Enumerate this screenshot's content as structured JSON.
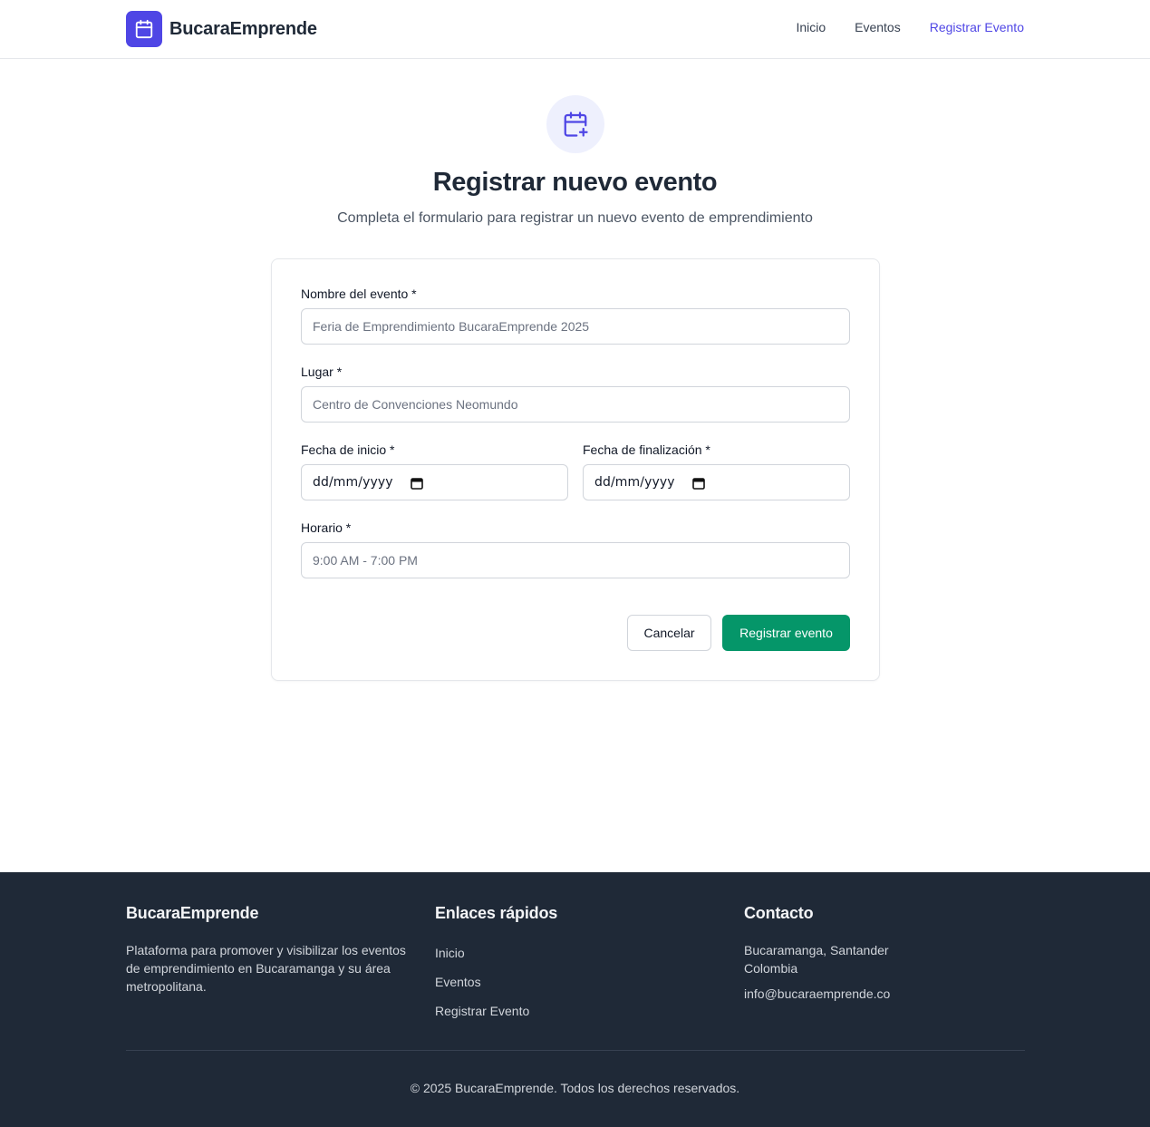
{
  "header": {
    "brand_name": "BucaraEmprende",
    "nav": [
      {
        "label": "Inicio",
        "active": false
      },
      {
        "label": "Eventos",
        "active": false
      },
      {
        "label": "Registrar Evento",
        "active": true
      }
    ]
  },
  "hero": {
    "icon": "calendar-plus-icon",
    "title": "Registrar nuevo evento",
    "subtitle": "Completa el formulario para registrar un nuevo evento de emprendimiento"
  },
  "form": {
    "name": {
      "label": "Nombre del evento *",
      "placeholder": "Feria de Emprendimiento BucaraEmprende 2025"
    },
    "place": {
      "label": "Lugar *",
      "placeholder": "Centro de Convenciones Neomundo"
    },
    "start_date": {
      "label": "Fecha de inicio *",
      "value": "dd/mm/yyyy"
    },
    "end_date": {
      "label": "Fecha de finalización *",
      "value": "dd/mm/yyyy"
    },
    "schedule": {
      "label": "Horario *",
      "placeholder": "9:00 AM - 7:00 PM"
    },
    "cancel_label": "Cancelar",
    "submit_label": "Registrar evento"
  },
  "footer": {
    "about": {
      "title": "BucaraEmprende",
      "text": "Plataforma para promover y visibilizar los eventos de emprendimiento en Bucaramanga y su área metropolitana."
    },
    "links": {
      "title": "Enlaces rápidos",
      "items": [
        "Inicio",
        "Eventos",
        "Registrar Evento"
      ]
    },
    "contact": {
      "title": "Contacto",
      "address": "Bucaramanga, Santander Colombia",
      "email": "info@bucaraemprende.co"
    },
    "copyright": "© 2025 BucaraEmprende. Todos los derechos reservados."
  },
  "colors": {
    "brand": "#4f46e5",
    "submit": "#059669",
    "footer_bg": "#1f2937"
  }
}
